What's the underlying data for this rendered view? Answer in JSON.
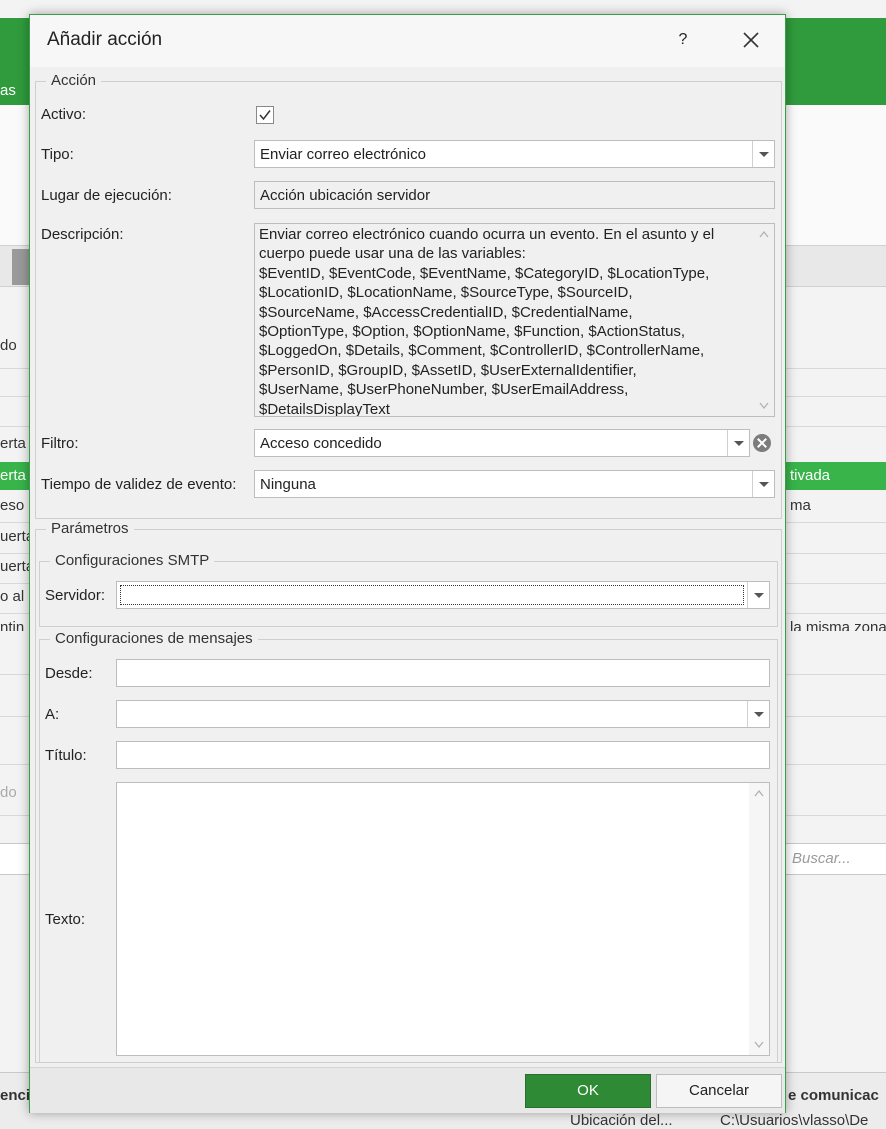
{
  "background": {
    "ribbon_text": "as",
    "row_labels": [
      "do",
      "erta",
      "erta",
      "eso",
      "uerta",
      "uerta",
      "o al a",
      "ntin",
      "do"
    ],
    "right_cells": [
      "tivada",
      "ma",
      "la misma zona"
    ],
    "search_placeholder": "Buscar...",
    "bottom_left": "enci",
    "bottom_right_header": "e comunicac",
    "bottom_row_col1": "Ubicación del...",
    "bottom_row_col2": "C:\\Usuarios\\vlasso\\De"
  },
  "dialog": {
    "title": "Añadir acción",
    "help_label": "?",
    "accion": {
      "legend": "Acción",
      "activo_label": "Activo:",
      "activo_checked": true,
      "tipo_label": "Tipo:",
      "tipo_value": "Enviar correo electrónico",
      "lugar_label": "Lugar de ejecución:",
      "lugar_value": "Acción ubicación servidor",
      "descripcion_label": "Descripción:",
      "descripcion_lines": [
        "Enviar correo electrónico cuando ocurra un evento. En el asunto y el",
        "cuerpo puede usar una de las variables:",
        "$EventID, $EventCode, $EventName, $CategoryID, $LocationType,",
        "$LocationID, $LocationName, $SourceType, $SourceID,",
        "$SourceName, $AccessCredentialID, $CredentialName,",
        "$OptionType, $Option, $OptionName, $Function, $ActionStatus,",
        "$LoggedOn, $Details, $Comment, $ControllerID, $ControllerName,",
        "$PersonID, $GroupID, $AssetID, $UserExternalIdentifier,",
        "$UserName, $UserPhoneNumber, $UserEmailAddress,",
        "$DetailsDisplayText"
      ],
      "filtro_label": "Filtro:",
      "filtro_value": "Acceso concedido",
      "tiempo_label": "Tiempo de validez de evento:",
      "tiempo_value": "Ninguna"
    },
    "parametros": {
      "legend": "Parámetros",
      "smtp": {
        "legend": "Configuraciones SMTP",
        "servidor_label": "Servidor:",
        "servidor_value": ""
      },
      "mensajes": {
        "legend": "Configuraciones de mensajes",
        "desde_label": "Desde:",
        "desde_value": "",
        "a_label": "A:",
        "a_value": "",
        "titulo_label": "Título:",
        "titulo_value": "",
        "texto_label": "Texto:",
        "texto_value": ""
      }
    },
    "buttons": {
      "ok": "OK",
      "cancel": "Cancelar"
    }
  },
  "colors": {
    "brand_green": "#2f9b3c",
    "selected_row_green": "#38b44a",
    "ok_button": "#2f8a35"
  }
}
